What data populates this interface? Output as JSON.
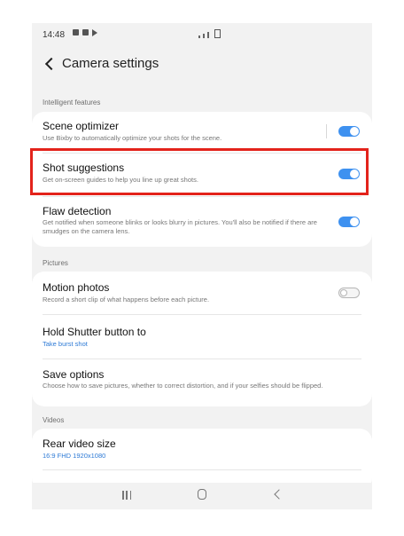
{
  "status_bar": {
    "time": "14:48"
  },
  "header": {
    "title": "Camera settings"
  },
  "sections": {
    "intelligent": "Intelligent features",
    "pictures": "Pictures",
    "videos": "Videos"
  },
  "settings": {
    "scene_optimizer": {
      "title": "Scene optimizer",
      "subtitle": "Use Bixby to automatically optimize your shots for the scene.",
      "enabled": true
    },
    "shot_suggestions": {
      "title": "Shot suggestions",
      "subtitle": "Get on-screen guides to help you line up great shots.",
      "enabled": true
    },
    "flaw_detection": {
      "title": "Flaw detection",
      "subtitle": "Get notified when someone blinks or looks blurry in pictures. You'll also be notified if there are smudges on the camera lens.",
      "enabled": true
    },
    "motion_photos": {
      "title": "Motion photos",
      "subtitle": "Record a short clip of what happens before each picture.",
      "enabled": false
    },
    "hold_shutter": {
      "title": "Hold Shutter button to",
      "value": "Take burst shot"
    },
    "save_options": {
      "title": "Save options",
      "subtitle": "Choose how to save pictures, whether to correct distortion, and if your selfies should be flipped."
    },
    "rear_video_size": {
      "title": "Rear video size",
      "value": "16:9 FHD 1920x1080"
    }
  },
  "colors": {
    "accent": "#3e91f0",
    "highlight": "#e3231b",
    "value_text": "#2d7ad6"
  }
}
